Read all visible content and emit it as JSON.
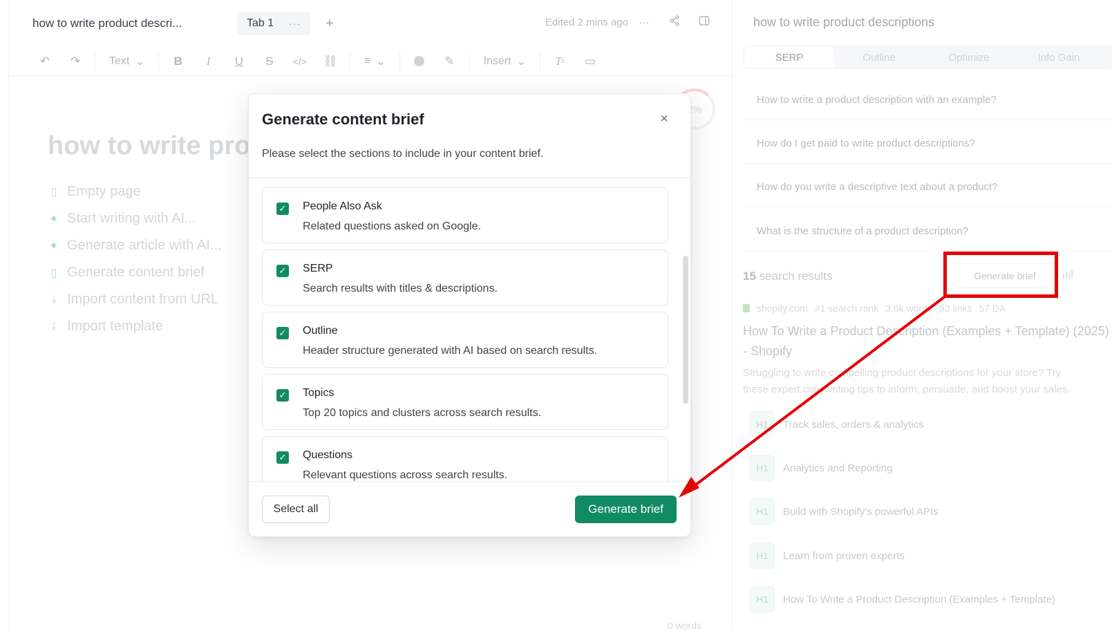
{
  "editor": {
    "doc_title": "how to write product descri...",
    "tab_label": "Tab 1",
    "tab_menu": "···",
    "add_tab": "+",
    "edited": "Edited 2 mins ago",
    "more": "···",
    "toolbar": {
      "text_style": "Text",
      "insert": "Insert"
    },
    "heading": "how to write pro",
    "actions": [
      {
        "label": "Empty page",
        "icon": "page-icon"
      },
      {
        "label": "Start writing with AI...",
        "icon": "sparkle-icon"
      },
      {
        "label": "Generate article with AI...",
        "icon": "sparkle-icon"
      },
      {
        "label": "Generate content brief",
        "icon": "document-icon"
      },
      {
        "label": "Import content from URL",
        "icon": "download-icon"
      },
      {
        "label": "Import template",
        "icon": "download-icon"
      }
    ],
    "score": "2%",
    "word_count": "0 words"
  },
  "panel": {
    "title": "how to write product descriptions",
    "tabs": [
      "SERP",
      "Outline",
      "Optimize",
      "Info Gain"
    ],
    "active_tab": "SERP",
    "paa": [
      "How to write a product description with an example?",
      "How do I get paid to write product descriptions?",
      "How do you write a descriptive text about a product?",
      "What is the structure of a product description?"
    ],
    "results_count": "15",
    "results_label": "search results",
    "generate_brief": "Generate brief",
    "result": {
      "domain": "shopify.com",
      "rank": "#1 search rank",
      "words": "3.6k words",
      "links": "53 links",
      "da": "57 DA",
      "title": "How To Write a Product Description (Examples + Template) (2025) - Shopify",
      "desc1": "Struggling to write compelling product descriptions for your store? Try",
      "desc2": "these expert copywriting tips to inform, persuade, and boost your sales."
    },
    "headings": [
      {
        "level": "H1",
        "text": "Track sales, orders & analytics"
      },
      {
        "level": "H1",
        "text": "Analytics and Reporting"
      },
      {
        "level": "H1",
        "text": "Build with Shopify's powerful APIs"
      },
      {
        "level": "H1",
        "text": "Learn from proven experts"
      },
      {
        "level": "H1",
        "text": "How To Write a Product Description (Examples + Template)"
      }
    ]
  },
  "modal": {
    "title": "Generate content brief",
    "close": "×",
    "subtitle": "Please select the sections to include in your content brief.",
    "sections": [
      {
        "title": "People Also Ask",
        "desc": "Related questions asked on Google.",
        "checked": true
      },
      {
        "title": "SERP",
        "desc": "Search results with titles & descriptions.",
        "checked": true
      },
      {
        "title": "Outline",
        "desc": "Header structure generated with AI based on search results.",
        "checked": true
      },
      {
        "title": "Topics",
        "desc": "Top 20 topics and clusters across search results.",
        "checked": true
      },
      {
        "title": "Questions",
        "desc": "Relevant questions across search results.",
        "checked": true
      }
    ],
    "select_all": "Select all",
    "generate": "Generate brief"
  },
  "colors": {
    "accent": "#128a63",
    "annotation": "#e60000"
  }
}
